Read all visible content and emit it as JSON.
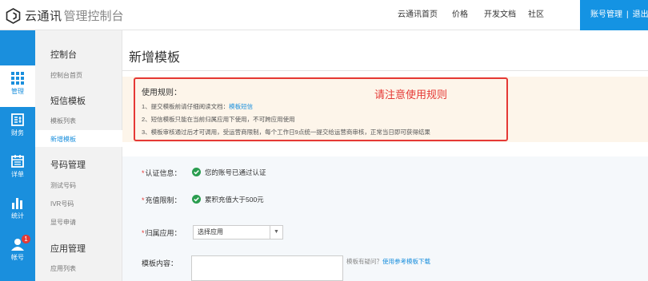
{
  "header": {
    "brand": "云通讯",
    "brand_sub": "管理控制台",
    "nav": [
      "云通讯首页",
      "价格",
      "开发文档",
      "社区"
    ],
    "account_btn": "账号管理",
    "account_sep": "|",
    "account_extra": "退出"
  },
  "rail": {
    "items": [
      {
        "label": "管理",
        "icon": "grid-icon"
      },
      {
        "label": "财务",
        "icon": "finance-icon"
      },
      {
        "label": "详单",
        "icon": "calendar-icon"
      },
      {
        "label": "统计",
        "icon": "bar-chart-icon"
      },
      {
        "label": "帐号",
        "icon": "user-icon",
        "badge": "1"
      }
    ]
  },
  "submenu": {
    "console_title": "控制台",
    "console_home": "控制台首页",
    "sms_title": "短信模板",
    "sms_list": "模板列表",
    "sms_new": "新增模板",
    "number_title": "号码管理",
    "test_number": "测试号码",
    "ivr_number": "IVR号码",
    "display_number": "显号申请",
    "app_title": "应用管理",
    "app_list": "应用列表"
  },
  "page": {
    "title": "新增模板"
  },
  "notice": {
    "title": "使用规则：",
    "rule1_prefix": "1、提交模板前请仔细阅读文档：",
    "rule1_link": "模板短信",
    "rule2": "2、短信模板只能在当前归属应用下使用，不可跨应用使用",
    "rule3": "3、模板审核通过后才可调用，受运营商限制，每个工作日9点统一提交给运营商审核，正常当日即可获得结果",
    "annotation": "请注意使用规则"
  },
  "form": {
    "req_mark": "*",
    "auth_label": "认证信息：",
    "auth_value": "您的账号已通过认证",
    "recharge_label": "充值限制：",
    "recharge_value": "累积充值大于500元",
    "app_label": "归属应用：",
    "app_select": "选择应用",
    "content_label": "模板内容：",
    "hint_prefix": "模板有疑问？",
    "hint_link": "使用参考模板下载"
  },
  "colors": {
    "primary": "#1a8fdd",
    "accent_red": "#e53935",
    "success": "#2a9d4f",
    "notice_bg": "#fdf5ea"
  }
}
